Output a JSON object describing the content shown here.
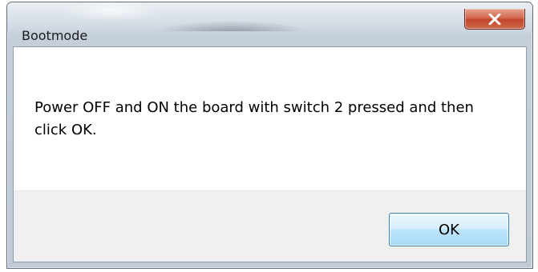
{
  "window": {
    "title": "Bootmode"
  },
  "dialog": {
    "message": "Power OFF and ON the board with switch 2 pressed and then click OK.",
    "ok_label": "OK"
  },
  "icons": {
    "close": "close-icon"
  }
}
